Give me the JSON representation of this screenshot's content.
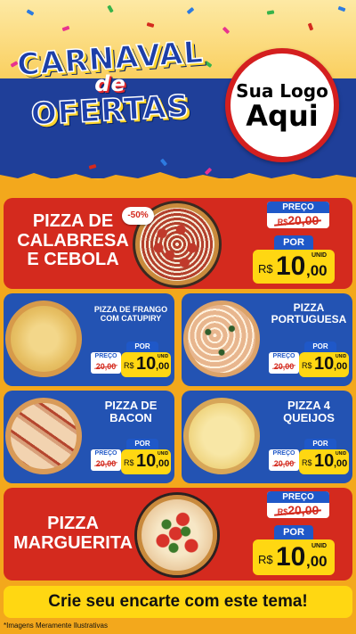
{
  "header": {
    "title_line1": "CARNAVAL",
    "title_line2": "de",
    "title_line3": "OFERTAS",
    "logo_line1": "Sua Logo",
    "logo_line2": "Aqui"
  },
  "labels": {
    "preco": "PREÇO",
    "por": "POR",
    "currency": "R$",
    "unid": "UNID"
  },
  "products": {
    "calabresa": {
      "name": "PIZZA DE CALABRESA E CEBOLA",
      "discount": "-50%",
      "old_price": "20,00",
      "price_int": "10",
      "price_dec": ",00"
    },
    "frango": {
      "name": "PIZZA DE FRANGO COM CATUPIRY",
      "old_price": "20,00",
      "price_int": "10",
      "price_dec": ",00"
    },
    "portuguesa": {
      "name": "PIZZA PORTUGUESA",
      "old_price": "20,00",
      "price_int": "10",
      "price_dec": ",00"
    },
    "bacon": {
      "name": "PIZZA DE BACON",
      "old_price": "20,00",
      "price_int": "10",
      "price_dec": ",00"
    },
    "queijos": {
      "name": "PIZZA 4 QUEIJOS",
      "old_price": "20,00",
      "price_int": "10",
      "price_dec": ",00"
    },
    "marguerita": {
      "name": "PIZZA MARGUERITA",
      "old_price": "20,00",
      "price_int": "10",
      "price_dec": ",00"
    }
  },
  "footer": {
    "cta": "Crie seu encarte com este tema!",
    "disclaimer": "*Imagens Meramente Ilustrativas"
  },
  "colors": {
    "background": "#f3a81c",
    "card_red": "#d42a1e",
    "card_blue": "#2353b3",
    "price_yellow": "#ffd712",
    "tag_blue": "#1f58c8"
  }
}
